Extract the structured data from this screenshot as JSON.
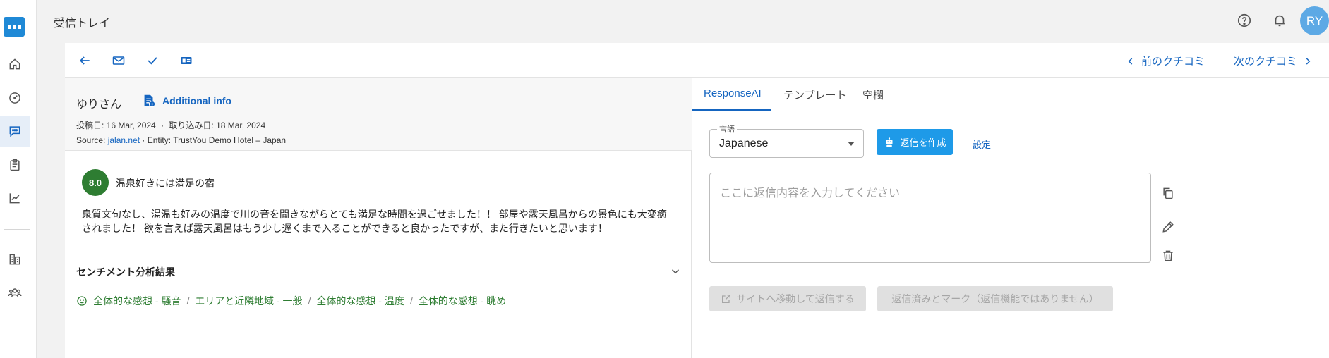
{
  "app": {
    "page_title": "受信トレイ",
    "avatar_initials": "RY",
    "brand_color": "#1f89d6",
    "accent_color": "#1565c0"
  },
  "sidebar": {
    "items": [
      {
        "name": "home",
        "icon": "home-icon"
      },
      {
        "name": "dashboard",
        "icon": "gauge-icon"
      },
      {
        "name": "inbox",
        "icon": "chat-icon",
        "active": true
      },
      {
        "name": "survey",
        "icon": "clipboard-icon"
      },
      {
        "name": "analytics",
        "icon": "chart-line-icon"
      },
      {
        "name": "hotel",
        "icon": "building-icon"
      },
      {
        "name": "users",
        "icon": "users-icon"
      }
    ]
  },
  "toolbar": {
    "prev_review": "前のクチコミ",
    "next_review": "次のクチコミ"
  },
  "review": {
    "reviewer": "ゆりさん",
    "additional_info": "Additional info",
    "posted": "投稿日: 16 Mar, 2024",
    "imported": "取り込み日: 18 Mar, 2024",
    "source_label": "Source:",
    "source_link": "jalan.net",
    "entity": "· Entity: TrustYou Demo Hotel – Japan",
    "score": "8.0",
    "title": "温泉好きには満足の宿",
    "body_line1": "泉質文句なし、湯温も好みの温度で川の音を聞きながらとても満足な時間を過ごせました！！ 部屋や露天風呂からの景色にも大変癒",
    "body_line2": "されました！ 欲を言えば露天風呂はもう少し遅くまで入ることができると良かったですが、また行きたいと思います！"
  },
  "sentiment": {
    "title": "センチメント分析結果",
    "tags": [
      "全体的な感想 - 騒音",
      "エリアと近隣地域 - 一般",
      "全体的な感想 - 温度",
      "全体的な感想 - 眺め"
    ],
    "separator": "/",
    "color": "#2e7d32"
  },
  "response": {
    "tabs": [
      "ResponseAI",
      "テンプレート",
      "空欄"
    ],
    "language_label": "言語",
    "language_value": "Japanese",
    "generate_button": "返信を作成",
    "settings_link": "設定",
    "reply_placeholder": "ここに返信内容を入力してください",
    "goto_site_button": "サイトへ移動して返信する",
    "mark_replied_button": "返信済みとマーク（返信機能ではありません）"
  }
}
